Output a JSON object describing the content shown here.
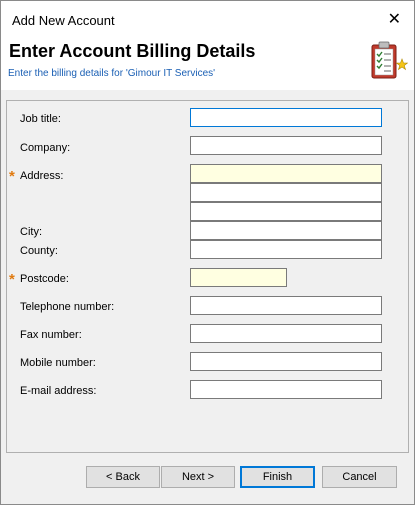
{
  "window": {
    "title": "Add New Account",
    "close_glyph": "✕"
  },
  "banner": {
    "heading": "Enter Account Billing Details",
    "subheading": "Enter the billing details for 'Gimour IT Services'",
    "icon": "clipboard-checklist-icon"
  },
  "form": {
    "job_title": {
      "label": "Job title:",
      "value": ""
    },
    "company": {
      "label": "Company:",
      "value": ""
    },
    "address": {
      "label": "Address:",
      "required": true,
      "lines": [
        "",
        "",
        ""
      ]
    },
    "city": {
      "label": "City:",
      "value": ""
    },
    "county": {
      "label": "County:",
      "value": ""
    },
    "postcode": {
      "label": "Postcode:",
      "required": true,
      "value": ""
    },
    "telephone": {
      "label": "Telephone number:",
      "value": ""
    },
    "fax": {
      "label": "Fax number:",
      "value": ""
    },
    "mobile": {
      "label": "Mobile number:",
      "value": ""
    },
    "email": {
      "label": "E-mail address:",
      "value": ""
    },
    "required_marker": "*"
  },
  "buttons": {
    "back": "< Back",
    "next": "Next >",
    "finish": "Finish",
    "cancel": "Cancel"
  },
  "colors": {
    "required_fill": "#ffffe1",
    "required_marker": "#e07a10",
    "link_text": "#1a5fb4",
    "focus_border": "#0078d7"
  }
}
